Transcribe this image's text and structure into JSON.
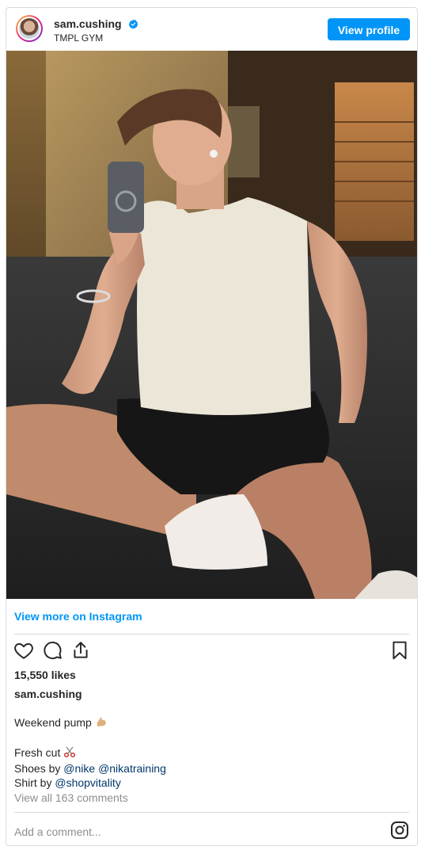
{
  "header": {
    "username": "sam.cushing",
    "location": "TMPL GYM",
    "view_profile_label": "View profile"
  },
  "links": {
    "view_more": "View more on Instagram"
  },
  "post": {
    "likes": "15,550 likes",
    "caption_username": "sam.cushing",
    "caption_line1": "Weekend pump",
    "caption_line2": "Fresh cut",
    "shoes_prefix": "Shoes by",
    "shoes_tag1": "@nike",
    "shoes_tag2": "@nikatraining",
    "shirt_prefix": "Shirt by",
    "shirt_tag": "@shopvitality",
    "view_comments": "View all 163 comments"
  },
  "comment_box": {
    "placeholder": "Add a comment..."
  },
  "colors": {
    "accent": "#0095f6",
    "tag": "#00376b",
    "muted": "#8e8e8e",
    "border": "#dbdbdb"
  },
  "icons": [
    "verified-badge-icon",
    "heart-icon",
    "comment-icon",
    "share-icon",
    "bookmark-icon",
    "instagram-icon",
    "flexed-biceps-emoji",
    "scissors-emoji"
  ]
}
